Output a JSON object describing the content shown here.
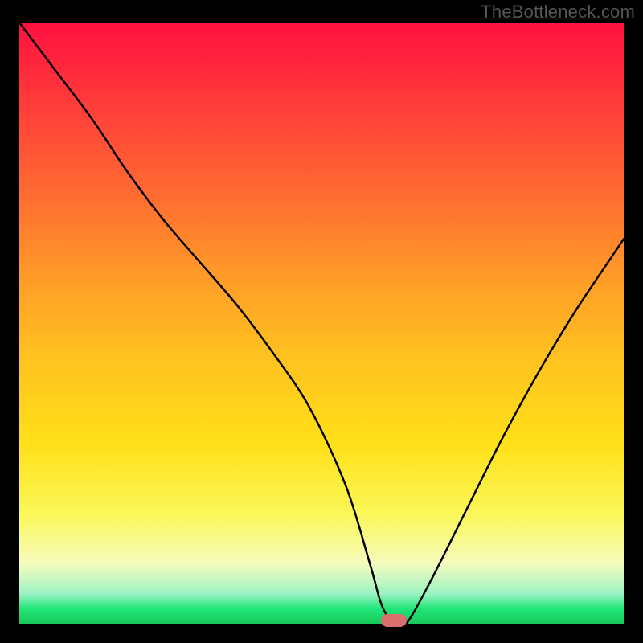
{
  "watermark": "TheBottleneck.com",
  "chart_data": {
    "type": "line",
    "title": "",
    "xlabel": "",
    "ylabel": "",
    "xlim": [
      0,
      100
    ],
    "ylim": [
      0,
      100
    ],
    "grid": false,
    "series": [
      {
        "name": "bottleneck-curve",
        "x": [
          0,
          6,
          12,
          18,
          24,
          30,
          36,
          42,
          48,
          54,
          58,
          60,
          62,
          64,
          68,
          74,
          80,
          86,
          92,
          98,
          100
        ],
        "values": [
          100,
          92,
          84,
          75,
          67,
          60,
          53,
          45,
          36,
          23,
          10,
          3,
          0,
          0,
          7,
          19,
          31,
          42,
          52,
          61,
          64
        ]
      }
    ],
    "annotations": [
      {
        "name": "optimal-marker",
        "x": 62,
        "y": 0
      }
    ],
    "background_gradient": {
      "top": "#ff1040",
      "mid": "#ffe018",
      "bottom": "#18c85a"
    }
  }
}
